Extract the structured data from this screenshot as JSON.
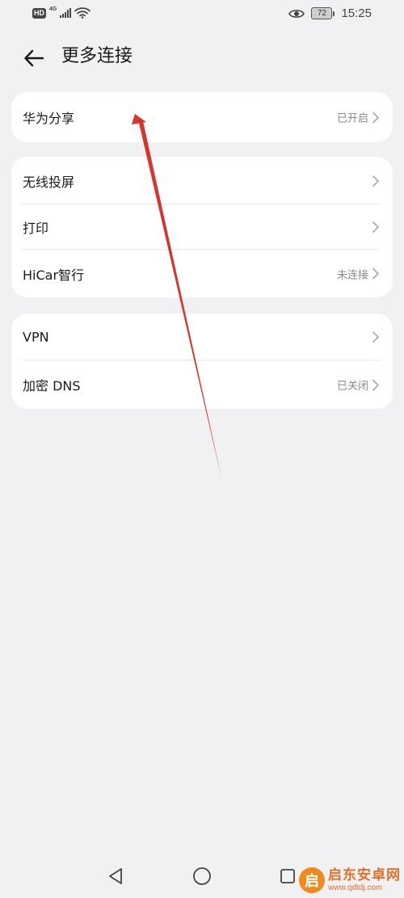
{
  "status_bar": {
    "hd": "HD",
    "network": "4G",
    "battery": "72",
    "time": "15:25"
  },
  "header": {
    "title": "更多连接"
  },
  "groups": [
    {
      "items": [
        {
          "label": "华为分享",
          "status": "已开启"
        }
      ]
    },
    {
      "items": [
        {
          "label": "无线投屏",
          "status": ""
        },
        {
          "label": "打印",
          "status": ""
        },
        {
          "label": "HiCar智行",
          "status": "未连接"
        }
      ]
    },
    {
      "items": [
        {
          "label": "VPN",
          "status": ""
        },
        {
          "label": "加密 DNS",
          "status": "已关闭"
        }
      ]
    }
  ],
  "watermark": {
    "logo": "启",
    "name": "启东安卓网",
    "url": "www.qdtdj.com"
  },
  "colors": {
    "background": "#f1f1f3",
    "card": "#ffffff",
    "annotation_arrow": "#d8342c",
    "secondary_text": "#8a8a8a"
  }
}
